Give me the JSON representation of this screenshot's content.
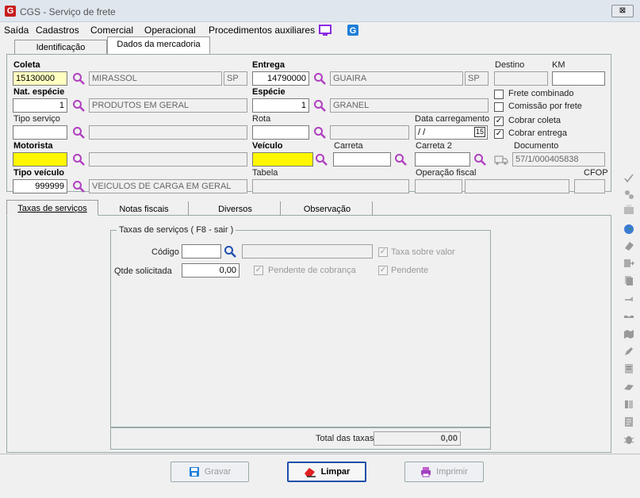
{
  "window": {
    "title": "CGS - Serviço de frete",
    "close": "⊠"
  },
  "menu": [
    "Saída",
    "Cadastros",
    "Comercial",
    "Operacional",
    "Procedimentos auxiliares"
  ],
  "tabs_top": [
    "Identificação",
    "Dados da mercadoria"
  ],
  "form": {
    "coleta": {
      "label": "Coleta",
      "code": "15130000",
      "city": "MIRASSOL",
      "uf": "SP"
    },
    "entrega": {
      "label": "Entrega",
      "code": "14790000",
      "city": "GUAIRA",
      "uf": "SP"
    },
    "destino": {
      "label": "Destino",
      "value": ""
    },
    "km": {
      "label": "KM",
      "value": ""
    },
    "nat_especie": {
      "label": "Nat. espécie",
      "code": "1",
      "desc": "PRODUTOS EM GERAL"
    },
    "especie": {
      "label": "Espécie",
      "code": "1",
      "desc": "GRANEL"
    },
    "tipo_servico": {
      "label": "Tipo serviço"
    },
    "rota": {
      "label": "Rota"
    },
    "data_carregamento": {
      "label": "Data carregamento",
      "value": " / /",
      "cal": "15"
    },
    "motorista": {
      "label": "Motorista"
    },
    "veiculo": {
      "label": "Veículo"
    },
    "carreta": {
      "label": "Carreta"
    },
    "carreta2": {
      "label": "Carreta 2"
    },
    "documento": {
      "label": "Documento",
      "value": "57/1/000405838"
    },
    "tipo_veiculo": {
      "label": "Tipo veículo",
      "code": "999999",
      "desc": "VEICULOS DE CARGA EM GERAL"
    },
    "tabela": {
      "label": "Tabela"
    },
    "operacao_fiscal": {
      "label": "Operação fiscal"
    },
    "cfop": {
      "label": "CFOP"
    },
    "checks": [
      {
        "label": "Frete combinado",
        "checked": false
      },
      {
        "label": "Comissão por frete",
        "checked": false
      },
      {
        "label": "Cobrar coleta",
        "checked": true
      },
      {
        "label": "Cobrar entrega",
        "checked": true
      }
    ]
  },
  "tabs_bottom": [
    "Taxas de serviços",
    "Notas fiscais",
    "Diversos",
    "Observação"
  ],
  "taxas": {
    "group_title": "Taxas de serviços  ( F8 - sair )",
    "codigo_label": "Código",
    "qtde_label": "Qtde solicitada",
    "qtde_value": "0,00",
    "taxa_sobre_valor": "Taxa sobre valor",
    "pendente_cobranca": "Pendente de cobrança",
    "pendente": "Pendente",
    "total_label": "Total das taxas",
    "total_value": "0,00"
  },
  "buttons": {
    "gravar": "Gravar",
    "limpar": "Limpar",
    "imprimir": "Imprimir"
  },
  "colors": {
    "yellow": "#fff700",
    "light_yellow": "#ffffc0",
    "magnifier": "#b040c0",
    "accent": "#1e4fa8"
  }
}
